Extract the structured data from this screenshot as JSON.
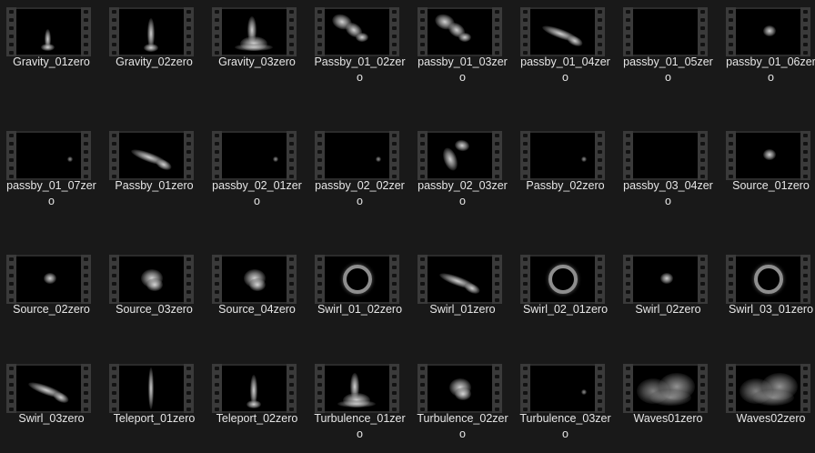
{
  "files": [
    {
      "name": "Gravity_01zero",
      "icon": "smoke-column-small"
    },
    {
      "name": "Gravity_02zero",
      "icon": "smoke-column"
    },
    {
      "name": "Gravity_03zero",
      "icon": "smoke-column-wide"
    },
    {
      "name": "Passby_01_02zero",
      "icon": "smoke-drift"
    },
    {
      "name": "passby_01_03zero",
      "icon": "smoke-drift"
    },
    {
      "name": "passby_01_04zero",
      "icon": "smoke-streak"
    },
    {
      "name": "passby_01_05zero",
      "icon": "blank"
    },
    {
      "name": "passby_01_06zero",
      "icon": "smoke-puff-small"
    },
    {
      "name": "passby_01_07zero",
      "icon": "smoke-dot"
    },
    {
      "name": "Passby_01zero",
      "icon": "smoke-streak"
    },
    {
      "name": "passby_02_01zero",
      "icon": "smoke-dot"
    },
    {
      "name": "passby_02_02zero",
      "icon": "smoke-dot"
    },
    {
      "name": "passby_02_03zero",
      "icon": "smoke-curl"
    },
    {
      "name": "Passby_02zero",
      "icon": "smoke-dot"
    },
    {
      "name": "passby_03_04zero",
      "icon": "blank"
    },
    {
      "name": "Source_01zero",
      "icon": "smoke-puff-small"
    },
    {
      "name": "Source_02zero",
      "icon": "smoke-puff-small"
    },
    {
      "name": "Source_03zero",
      "icon": "smoke-puff"
    },
    {
      "name": "Source_04zero",
      "icon": "smoke-puff"
    },
    {
      "name": "Swirl_01_02zero",
      "icon": "smoke-ring"
    },
    {
      "name": "Swirl_01zero",
      "icon": "smoke-streak"
    },
    {
      "name": "Swirl_02_01zero",
      "icon": "smoke-ring"
    },
    {
      "name": "Swirl_02zero",
      "icon": "smoke-puff-small"
    },
    {
      "name": "Swirl_03_01zero",
      "icon": "smoke-ring"
    },
    {
      "name": "Swirl_03zero",
      "icon": "smoke-streak"
    },
    {
      "name": "Teleport_01zero",
      "icon": "smoke-column-thin"
    },
    {
      "name": "Teleport_02zero",
      "icon": "smoke-column"
    },
    {
      "name": "Turbulence_01zero",
      "icon": "smoke-column-wide"
    },
    {
      "name": "Turbulence_02zero",
      "icon": "smoke-puff"
    },
    {
      "name": "Turbulence_03zero",
      "icon": "smoke-dot"
    },
    {
      "name": "Waves01zero",
      "icon": "smoke-cloud"
    },
    {
      "name": "Waves02zero",
      "icon": "smoke-cloud"
    }
  ]
}
